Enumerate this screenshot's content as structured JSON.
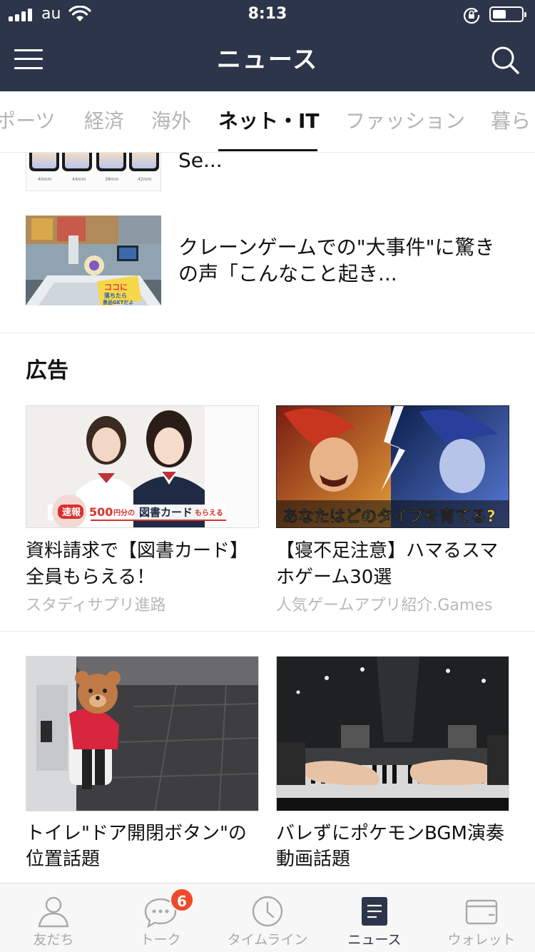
{
  "status_bar": {
    "carrier": "au",
    "time": "8:13"
  },
  "header": {
    "title": "ニュース"
  },
  "tabs": [
    {
      "label": "ポーツ",
      "active": false
    },
    {
      "label": "経済",
      "active": false
    },
    {
      "label": "海外",
      "active": false
    },
    {
      "label": "ネット・IT",
      "active": true
    },
    {
      "label": "ファッション",
      "active": false
    },
    {
      "label": "暮ら",
      "active": false
    }
  ],
  "feed": {
    "items": [
      {
        "title_line1": "Se...",
        "thumb_labels": [
          "40mm",
          "44mm",
          "38mm",
          "42mm"
        ]
      },
      {
        "title_line1": "クレーンゲームでの\"大事件\"に驚き",
        "title_line2": "の声「こんなこと起き...",
        "thumb_text": [
          "ココに",
          "落ちたら",
          "景品GETだよ"
        ]
      }
    ]
  },
  "ads": {
    "section_title": "広告",
    "cards": [
      {
        "title_line1": "資料請求で【図書カード】",
        "title_line2": "全員もらえる！",
        "source": "スタディサプリ進路",
        "banner_flash": "速報",
        "banner_amount": "500",
        "banner_unit": "円分の",
        "banner_main": "図書カード",
        "banner_tail": "もらえる"
      },
      {
        "title_line1": "【寝不足注意】ハマるスマ",
        "title_line2": "ホゲーム30選",
        "source": "人気ゲームアプリ紹介.Games",
        "banner": "あなたはどのタイプを育てる?"
      }
    ]
  },
  "more_cards": [
    {
      "title_line1": "トイレ\"ドア開閉ボタン\"の",
      "title_line2": "位置話題"
    },
    {
      "title_line1": "バレずにポケモンBGM演奏",
      "title_line2": "動画話題"
    }
  ],
  "bottom_nav": [
    {
      "label": "友だち",
      "icon": "friends-icon",
      "active": false
    },
    {
      "label": "トーク",
      "icon": "chat-icon",
      "active": false,
      "badge": "6"
    },
    {
      "label": "タイムライン",
      "icon": "clock-icon",
      "active": false
    },
    {
      "label": "ニュース",
      "icon": "news-icon",
      "active": true
    },
    {
      "label": "ウォレット",
      "icon": "wallet-icon",
      "active": false
    }
  ],
  "colors": {
    "header_bg": "#2c3549",
    "badge": "#ee4a2a",
    "inactive_text": "#b4b4b4"
  }
}
